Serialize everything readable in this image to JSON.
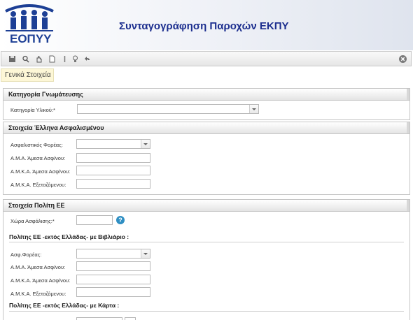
{
  "header": {
    "logo_text": "ΕΟΠΥΥ",
    "title": "Συνταγογράφηση Παροχών ΕΚΠΥ",
    "title_color": "#1d2f8f"
  },
  "toolbar": {
    "icons": [
      "save-icon",
      "search-icon",
      "hand-icon",
      "document-icon",
      "pin-icon",
      "bulb-icon",
      "undo-icon"
    ],
    "close_icon": "close-icon"
  },
  "tab": {
    "label": "Γενικά Στοιχεία",
    "bg": "#fdf7d7"
  },
  "sections": {
    "opinion": {
      "title": "Κατηγορία Γνωμάτευσης",
      "category_label": "Κατηγορία Υλικού:*"
    },
    "greek_insured": {
      "title": "Στοιχεία Έλληνα Ασφαλισμένου",
      "fund_label": "Ασφαλιστικός Φορέας:",
      "ama_label": "Α.Μ.Α. Άμεσα Ασφ/νου:",
      "amka_direct_label": "Α.Μ.Κ.Α. Άμεσα Ασφ/νου:",
      "amka_exam_label": "Α.Μ.Κ.Α. Εξεταζόμενου:"
    },
    "eu_citizen": {
      "title": "Στοιχεία Πολίτη ΕΕ",
      "country_label": "Χώρα Ασφάλισης:*",
      "help_icon": "help-icon",
      "booklet_heading": "Πολίτης ΕΕ -εκτός Ελλάδας- με Βιβλιάριο :",
      "fund_label": "Ασφ.Φορέας:",
      "ama_label": "Α.Μ.Α. Άμεσα Ασφ/νου:",
      "amka_direct_label": "Α.Μ.Κ.Α. Άμεσα Ασφ/νου:",
      "amka_exam_label": "Α.Μ.Κ.Α. Εξεταζόμενου:",
      "card_heading": "Πολίτης ΕΕ -εκτός Ελλάδας- με Κάρτα :"
    }
  }
}
